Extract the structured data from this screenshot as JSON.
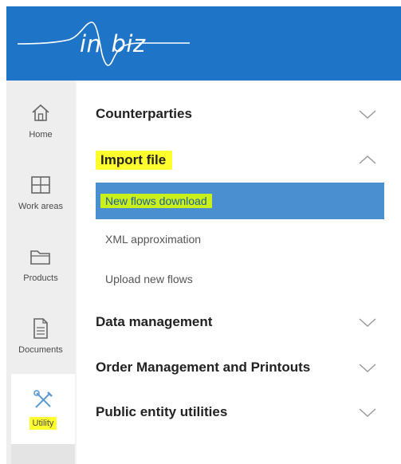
{
  "header": {
    "logo_text": "in biz",
    "logo_part1": "in",
    "logo_part2": "biz"
  },
  "sidebar": {
    "items": [
      {
        "label": "Home",
        "icon": "home-icon"
      },
      {
        "label": "Work areas",
        "icon": "grid-icon"
      },
      {
        "label": "Products",
        "icon": "folder-icon"
      },
      {
        "label": "Documents",
        "icon": "document-icon"
      },
      {
        "label": "Utility",
        "icon": "tools-icon"
      }
    ],
    "active": "Utility"
  },
  "menu": {
    "sections": [
      {
        "label": "Counterparties",
        "expanded": false
      },
      {
        "label": "Import file",
        "expanded": true,
        "items": [
          {
            "label": "New flows download",
            "selected": true
          },
          {
            "label": "XML approximation",
            "selected": false
          },
          {
            "label": "Upload new flows",
            "selected": false
          }
        ]
      },
      {
        "label": "Data management",
        "expanded": false
      },
      {
        "label": "Order Management and Printouts",
        "expanded": false
      },
      {
        "label": "Public entity utilities",
        "expanded": false
      }
    ]
  },
  "colors": {
    "header": "#1e74c6",
    "highlight": "#ffff2e",
    "selected_row": "#4a90d0",
    "selected_text_bg": "#c9f01a"
  }
}
